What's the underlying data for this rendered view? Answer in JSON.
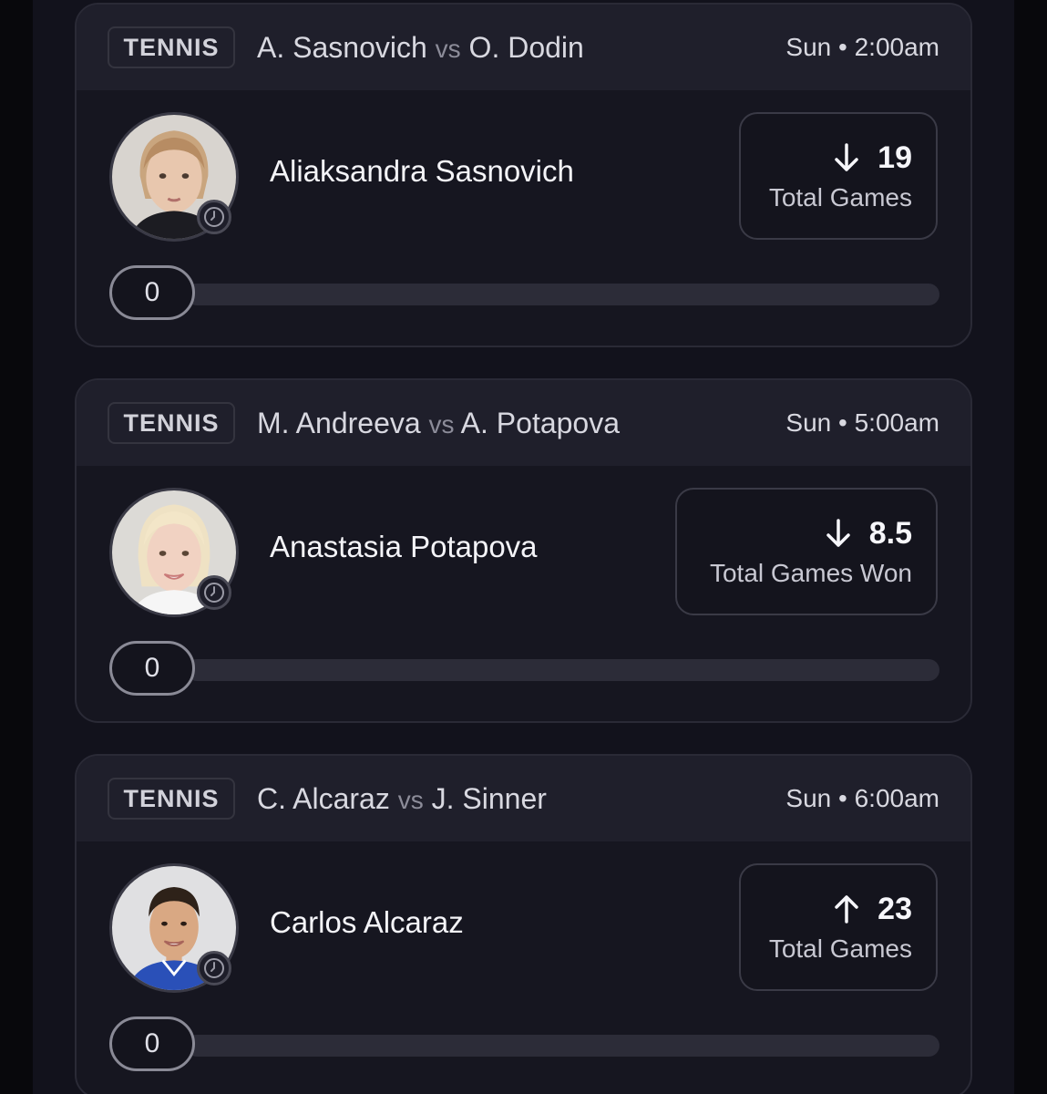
{
  "cards": [
    {
      "sport": "TENNIS",
      "player_a": "A. Sasnovich",
      "vs": "vs",
      "player_b": "O. Dodin",
      "time": "Sun • 2:00am",
      "player_name": "Aliaksandra Sasnovich",
      "direction": "down",
      "direction_icon": "arrow-down-icon",
      "line": "19",
      "stat": "Total Games",
      "progress_value": "0",
      "progress_fraction": 0
    },
    {
      "sport": "TENNIS",
      "player_a": "M. Andreeva",
      "vs": "vs",
      "player_b": "A. Potapova",
      "time": "Sun • 5:00am",
      "player_name": "Anastasia Potapova",
      "direction": "down",
      "direction_icon": "arrow-down-icon",
      "line": "8.5",
      "stat": "Total Games Won",
      "progress_value": "0",
      "progress_fraction": 0
    },
    {
      "sport": "TENNIS",
      "player_a": "C. Alcaraz",
      "vs": "vs",
      "player_b": "J. Sinner",
      "time": "Sun • 6:00am",
      "player_name": "Carlos Alcaraz",
      "direction": "up",
      "direction_icon": "arrow-up-icon",
      "line": "23",
      "stat": "Total Games",
      "progress_value": "0",
      "progress_fraction": 0
    }
  ],
  "colors": {
    "background": "#12121c",
    "card": "#161620",
    "card_header": "#1f1f2b",
    "border": "#2a2a36",
    "text": "#f2f2f5",
    "muted": "#8c8c99"
  }
}
